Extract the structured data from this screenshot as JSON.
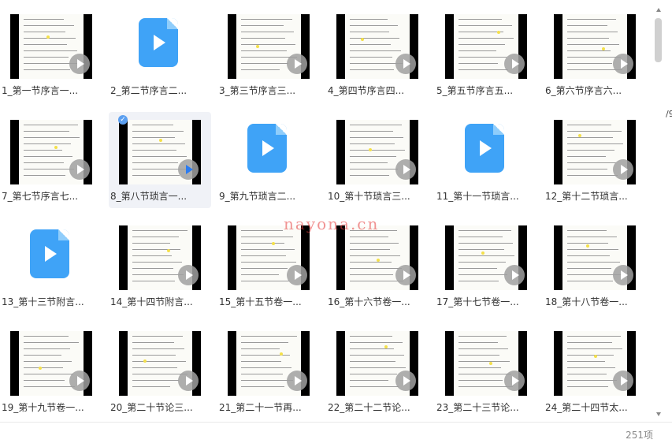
{
  "items": [
    {
      "label": "1_第一节序言一...",
      "type": "doc"
    },
    {
      "label": "2_第二节序言二...",
      "type": "video"
    },
    {
      "label": "3_第三节序言三...",
      "type": "doc"
    },
    {
      "label": "4_第四节序言四...",
      "type": "doc"
    },
    {
      "label": "5_第五节序言五...",
      "type": "doc"
    },
    {
      "label": "6_第六节序言六...",
      "type": "doc"
    },
    {
      "label": "7_第七节序言七...",
      "type": "doc"
    },
    {
      "label": "8_第八节琐言一...",
      "type": "doc",
      "selected": true
    },
    {
      "label": "9_第九节琐言二...",
      "type": "video"
    },
    {
      "label": "10_第十节琐言三...",
      "type": "doc"
    },
    {
      "label": "11_第十一节琐言...",
      "type": "video"
    },
    {
      "label": "12_第十二节琐言...",
      "type": "doc"
    },
    {
      "label": "13_第十三节附言...",
      "type": "video"
    },
    {
      "label": "14_第十四节附言...",
      "type": "doc"
    },
    {
      "label": "15_第十五节卷一...",
      "type": "doc"
    },
    {
      "label": "16_第十六节卷一...",
      "type": "doc"
    },
    {
      "label": "17_第十七节卷一...",
      "type": "doc"
    },
    {
      "label": "18_第十八节卷一...",
      "type": "doc"
    },
    {
      "label": "19_第十九节卷一...",
      "type": "doc"
    },
    {
      "label": "20_第二十节论三...",
      "type": "doc"
    },
    {
      "label": "21_第二十一节再...",
      "type": "doc"
    },
    {
      "label": "22_第二十二节论...",
      "type": "doc"
    },
    {
      "label": "23_第二十三节论...",
      "type": "doc"
    },
    {
      "label": "24_第二十四节太...",
      "type": "doc"
    }
  ],
  "watermark": "nayona.cn",
  "status": {
    "count": "251项"
  },
  "edge_glyph": "/9",
  "colors": {
    "accent": "#3fa3f7",
    "selected_bg": "#f0f2f7",
    "watermark": "#e63c3c"
  }
}
